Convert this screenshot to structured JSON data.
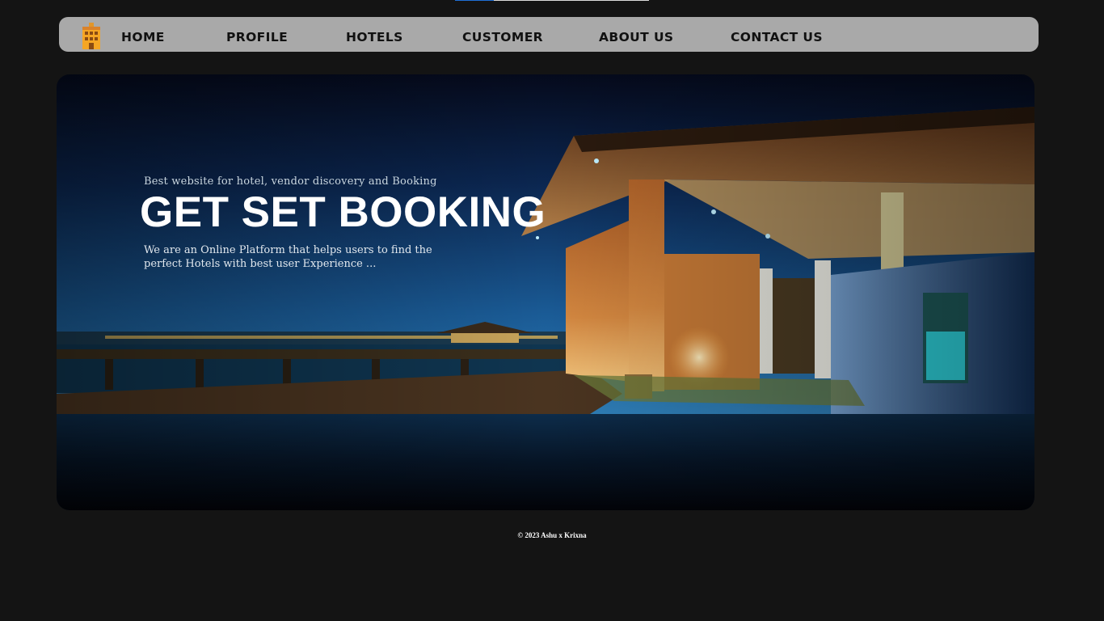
{
  "top_progress": {
    "value_percent": 20,
    "track_color": "#dcdcdc",
    "fill_color": "#1f6fd6"
  },
  "nav": {
    "logo_icon": "hotel-building-icon",
    "items": [
      {
        "label": "HOME"
      },
      {
        "label": "PROFILE"
      },
      {
        "label": "HOTELS"
      },
      {
        "label": "CUSTOMER"
      },
      {
        "label": "ABOUT US"
      },
      {
        "label": "CONTACT US"
      }
    ],
    "background_color": "#a9a9a9"
  },
  "hero": {
    "tagline": "Best website for hotel, vendor discovery and Booking",
    "title": "GET SET BOOKING",
    "description": "We are an Online Platform that helps users to find the perfect Hotels with best user Experience ...",
    "image": "night-resort-pavilion-photo"
  },
  "footer": {
    "copyright": "© 2023 Ashu x Krixna"
  }
}
